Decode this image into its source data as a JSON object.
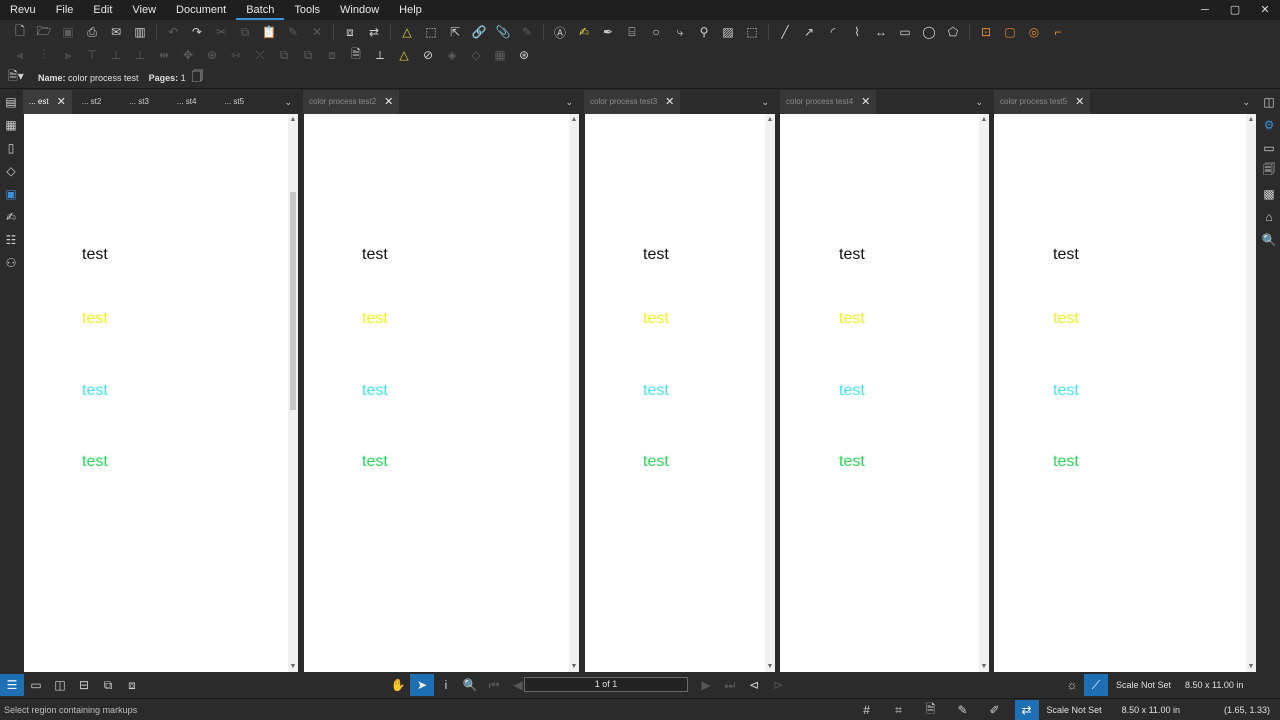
{
  "menu": [
    "Revu",
    "File",
    "Edit",
    "View",
    "Document",
    "Batch",
    "Tools",
    "Window",
    "Help"
  ],
  "active_menu": "Batch",
  "window_controls": [
    "─",
    "▢",
    "✕"
  ],
  "docbar": {
    "name_label": "Name:",
    "name_value": "color process test",
    "pages_label": "Pages:",
    "pages_value": "1"
  },
  "sample_words": {
    "black": "test",
    "yellow": "test",
    "cyan": "test",
    "green": "test"
  },
  "colors": {
    "black": "#111111",
    "yellow": "#f2f21a",
    "cyan": "#3fe6f0",
    "green": "#27d85a",
    "accent": "#3a8fd6"
  },
  "panes": [
    {
      "tabs": [
        {
          "label": "... est",
          "close": "✕",
          "state": "selected"
        },
        {
          "label": "... st2",
          "state": "normal"
        },
        {
          "label": "... st3",
          "state": "normal"
        },
        {
          "label": "... st4",
          "state": "normal"
        },
        {
          "label": "... st5",
          "state": "normal"
        }
      ]
    },
    {
      "tabs": [
        {
          "label": "color process test2",
          "close": "✕",
          "state": "muted"
        }
      ]
    },
    {
      "tabs": [
        {
          "label": "color process test3",
          "close": "✕",
          "state": "muted"
        }
      ]
    },
    {
      "tabs": [
        {
          "label": "color process test4",
          "close": "✕",
          "state": "muted"
        }
      ]
    },
    {
      "tabs": [
        {
          "label": "color process test5",
          "close": "✕",
          "state": "muted"
        }
      ]
    }
  ],
  "page_indicator": "1 of 1",
  "bottom_right": {
    "scale": "Scale Not Set",
    "paper": "8.50 x 11.00 in"
  },
  "status": {
    "message": "Select region containing markups",
    "scale": "Scale Not Set",
    "paper": "8.50 x 11.00 in",
    "coords": "(1.65, 1.33)"
  }
}
